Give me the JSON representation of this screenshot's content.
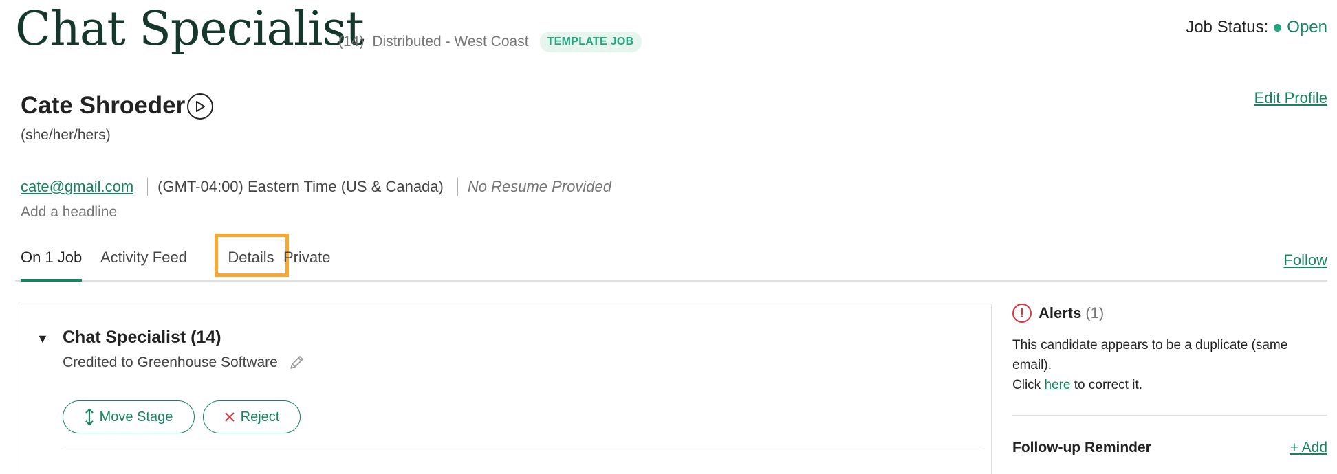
{
  "header": {
    "job_title": "Chat Specialist",
    "job_count": "(14)",
    "location": "Distributed - West Coast",
    "badge": "TEMPLATE JOB",
    "status_label": "Job Status:",
    "status_value": "Open"
  },
  "candidate": {
    "name": "Cate Shroeder",
    "pronouns": "(she/her/hers)",
    "edit_profile": "Edit Profile",
    "email": "cate@gmail.com",
    "timezone": "(GMT-04:00) Eastern Time (US & Canada)",
    "resume": "No Resume Provided",
    "headline_placeholder": "Add a headline"
  },
  "tabs": [
    {
      "label": "On 1 Job",
      "active": true
    },
    {
      "label": "Activity Feed",
      "active": false
    },
    {
      "label": "Details",
      "active": false,
      "highlighted": true
    },
    {
      "label": "Private",
      "active": false
    }
  ],
  "follow_label": "Follow",
  "job_panel": {
    "title": "Chat Specialist (14)",
    "credited": "Credited to Greenhouse Software",
    "move_stage": "Move Stage",
    "reject": "Reject"
  },
  "alerts": {
    "label": "Alerts",
    "count": "(1)",
    "text_1": "This candidate appears to be a duplicate (same email).",
    "text_2_prefix": "Click",
    "link": "here",
    "text_2_suffix": "to correct it."
  },
  "followup": {
    "label": "Follow-up Reminder",
    "add": "+ Add"
  },
  "colors": {
    "brand_green": "#15845f",
    "title_dark_green": "#15372c",
    "highlight_orange": "#f7a833",
    "alert_red": "#d9363e"
  }
}
